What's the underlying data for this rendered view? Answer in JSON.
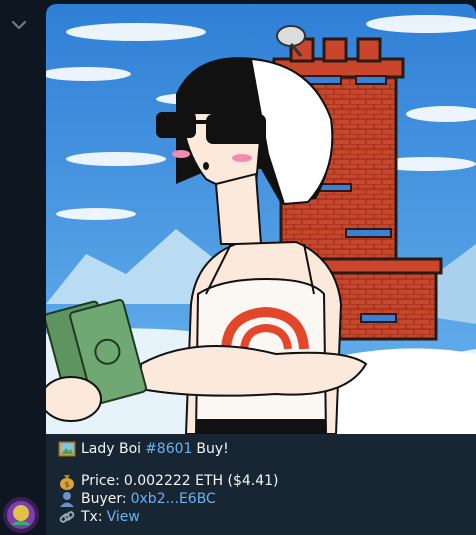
{
  "icons": {
    "scroll": "chevron-down-icon",
    "title_emoji": "framed-picture-icon",
    "price_emoji": "money-bag-icon",
    "buyer_emoji": "bust-silhouette-icon",
    "tx_emoji": "link-icon"
  },
  "message": {
    "title_name": "Lady Boi",
    "title_hashtag": "#8601",
    "title_action": "Buy!",
    "price_label": "Price:",
    "price_value": "0.002222 ETH ($4.41)",
    "buyer_label": "Buyer:",
    "buyer_value": "0xb2...E6BC",
    "tx_label": "Tx:",
    "tx_value": "View"
  },
  "colors": {
    "background": "#0e1621",
    "bubble": "#182533",
    "text": "#f5f5f5",
    "link": "#6ab3f3"
  }
}
